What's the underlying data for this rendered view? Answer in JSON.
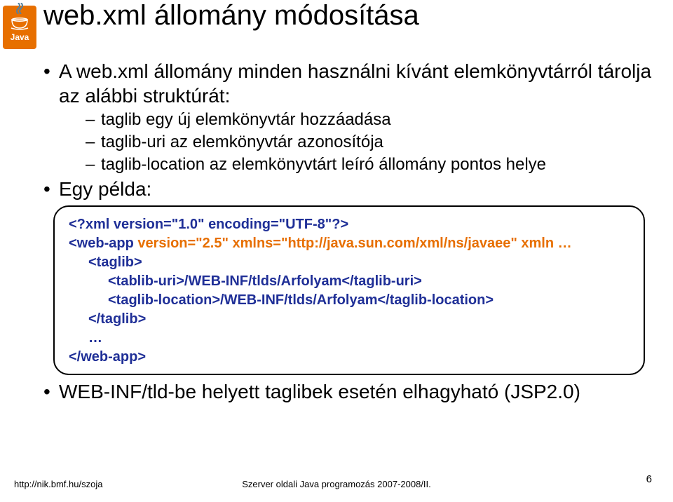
{
  "logo": {
    "text": "Java"
  },
  "title": "web.xml állomány módosítása",
  "bullets": {
    "b1": "A web.xml állomány minden használni kívánt elemkönyvtárról tárolja az alábbi struktúrát:",
    "b1a": "taglib egy új elemkönyvtár hozzáadása",
    "b1b": "taglib-uri az elemkönyvtár azonosítója",
    "b1c": "taglib-location az elemkönyvtárt leíró állomány pontos helye",
    "b2": "Egy példa:",
    "b3": "WEB-INF/tld-be helyett taglibek esetén elhagyható (JSP2.0)"
  },
  "code": {
    "l1": "<?xml version=\"1.0\" encoding=\"UTF-8\"?>",
    "l2a": "<web-app ",
    "l2b": "version=\"2.5\" xmlns=\"http://java.sun.com/xml/ns/javaee\" xmln …",
    "l3": "<taglib>",
    "l4": "<tablib-uri>/WEB-INF/tlds/Arfolyam</taglib-uri>",
    "l5": "<taglib-location>/WEB-INF/tlds/Arfolyam</taglib-location>",
    "l6": "</taglib>",
    "l7": "…",
    "l8": "</web-app>"
  },
  "footer": {
    "url": "http://nik.bmf.hu/szoja",
    "center": "Szerver oldali Java programozás 2007-2008/II.",
    "page": "6"
  }
}
